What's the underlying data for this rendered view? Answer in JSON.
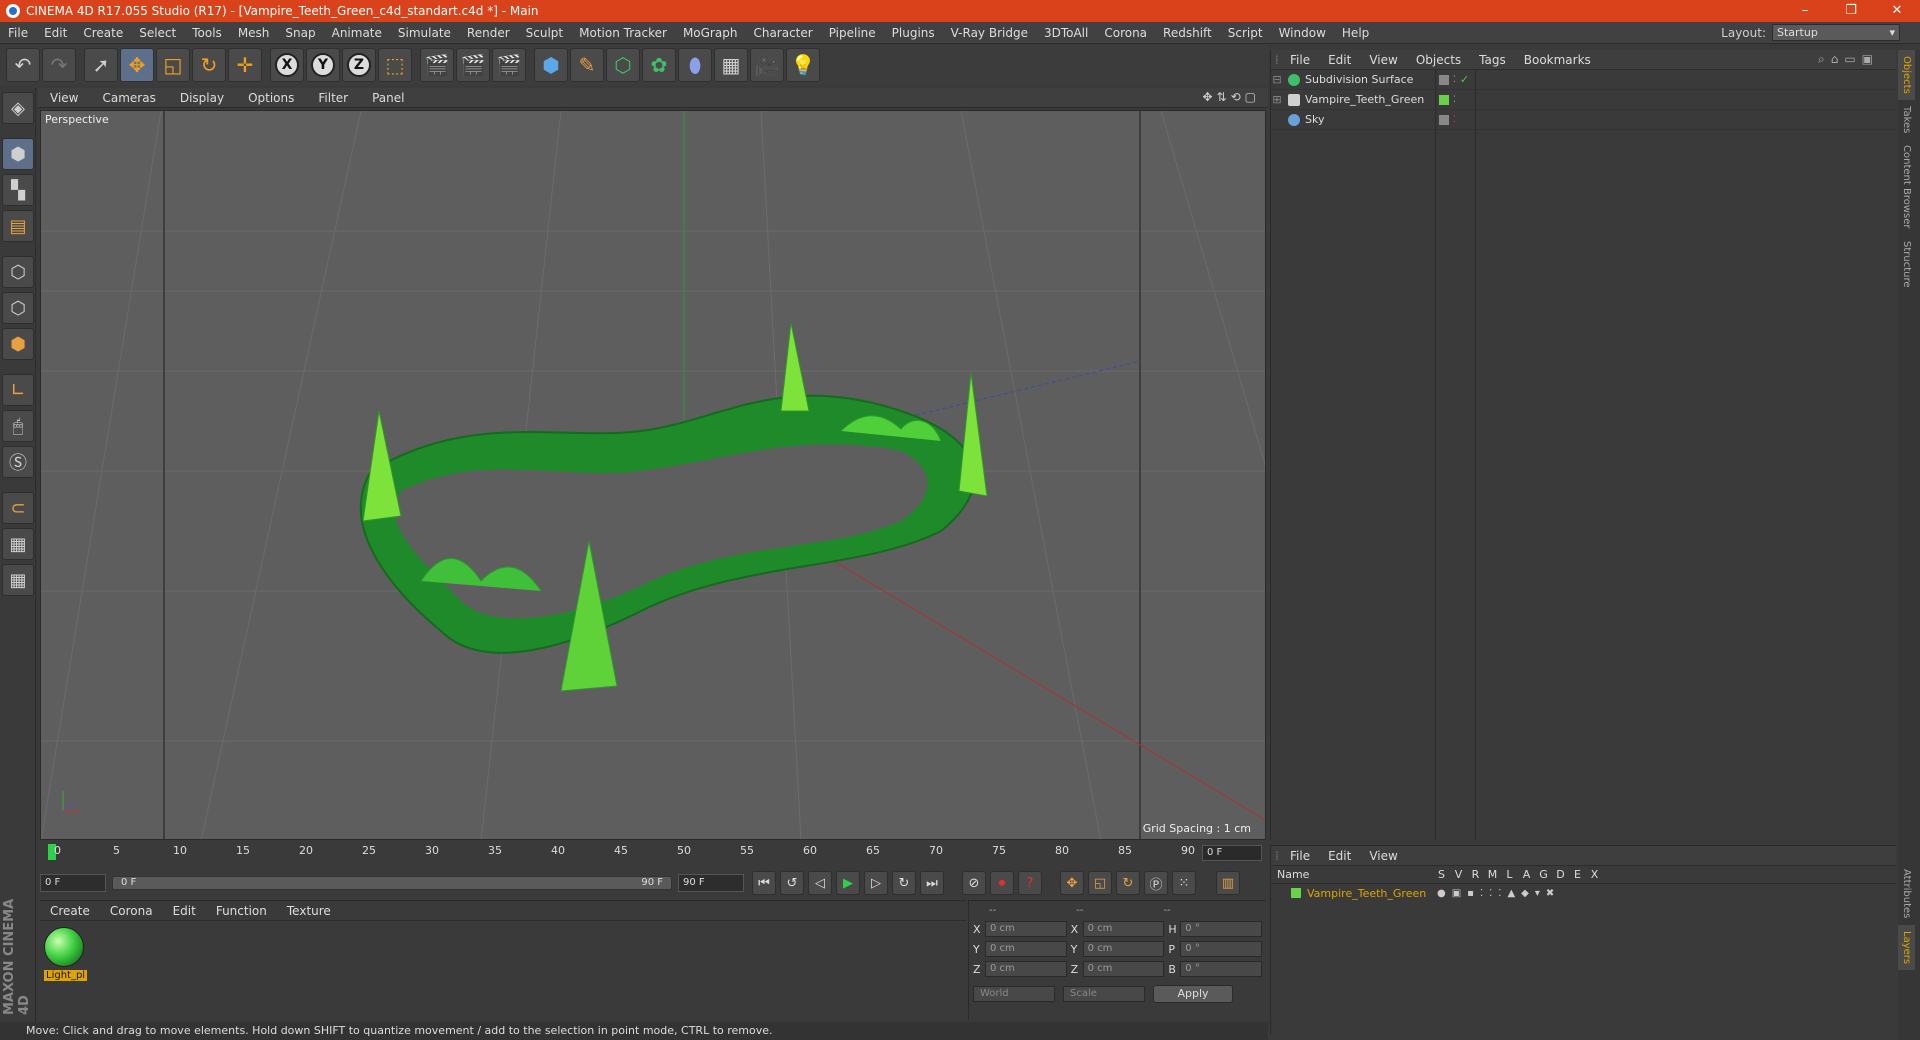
{
  "window": {
    "title": "CINEMA 4D R17.055 Studio (R17) - [Vampire_Teeth_Green_c4d_standart.c4d *] - Main",
    "controls": [
      "–",
      "❐",
      "✕"
    ]
  },
  "menubar": {
    "items": [
      "File",
      "Edit",
      "Create",
      "Select",
      "Tools",
      "Mesh",
      "Snap",
      "Animate",
      "Simulate",
      "Render",
      "Sculpt",
      "Motion Tracker",
      "MoGraph",
      "Character",
      "Pipeline",
      "Plugins",
      "V-Ray Bridge",
      "3DToAll",
      "Corona",
      "Redshift",
      "Script",
      "Window",
      "Help"
    ],
    "layout_label": "Layout:",
    "layout_value": "Startup"
  },
  "viewport": {
    "menu": [
      "View",
      "Cameras",
      "Display",
      "Options",
      "Filter",
      "Panel"
    ],
    "camera_label": "Perspective",
    "grid_spacing": "Grid Spacing : 1 cm"
  },
  "timeline": {
    "ticks": [
      "0",
      "5",
      "10",
      "15",
      "20",
      "25",
      "30",
      "35",
      "40",
      "45",
      "50",
      "55",
      "60",
      "65",
      "70",
      "75",
      "80",
      "85",
      "90"
    ],
    "current_frame": "0 F"
  },
  "transport": {
    "start_frame": "0 F",
    "slider_start": "0 F",
    "slider_end": "90 F",
    "end_frame": "90 F"
  },
  "material_manager": {
    "menu": [
      "Create",
      "Corona",
      "Edit",
      "Function",
      "Texture"
    ],
    "materials": [
      {
        "name": "Light_pl"
      }
    ]
  },
  "coordinates": {
    "headers": [
      "--",
      "--",
      "--"
    ],
    "rows": [
      {
        "a_label": "X",
        "a_value": "0 cm",
        "b_label": "X",
        "b_value": "0 cm",
        "c_label": "H",
        "c_value": "0 °"
      },
      {
        "a_label": "Y",
        "a_value": "0 cm",
        "b_label": "Y",
        "b_value": "0 cm",
        "c_label": "P",
        "c_value": "0 °"
      },
      {
        "a_label": "Z",
        "a_value": "0 cm",
        "b_label": "Z",
        "b_value": "0 cm",
        "c_label": "B",
        "c_value": "0 °"
      }
    ],
    "mode_select": "World",
    "transform_select": "Scale",
    "apply_label": "Apply"
  },
  "object_manager": {
    "menu": [
      "File",
      "Edit",
      "View",
      "Objects",
      "Tags",
      "Bookmarks"
    ],
    "objects": [
      {
        "name": "Subdivision Surface",
        "icon_color": "#3fbf6a"
      },
      {
        "name": "Vampire_Teeth_Green",
        "icon_color": "#cfcfcf"
      },
      {
        "name": "Sky",
        "icon_color": "#6aa0d8"
      }
    ]
  },
  "side_tabs": [
    "Objects",
    "Takes",
    "Content Browser",
    "Structure"
  ],
  "side_tabs_bottom": [
    "Attributes",
    "Layers"
  ],
  "layer_manager": {
    "menu": [
      "File",
      "Edit",
      "View"
    ],
    "columns": [
      "Name",
      "S",
      "V",
      "R",
      "M",
      "L",
      "A",
      "G",
      "D",
      "E",
      "X"
    ],
    "layers": [
      {
        "name": "Vampire_Teeth_Green",
        "color": "#69d14a"
      }
    ]
  },
  "status": "Move: Click and drag to move elements. Hold down SHIFT to quantize movement / add to the selection in point mode, CTRL to remove.",
  "logo": {
    "brand": "MAXON",
    "product": "CINEMA 4D"
  },
  "colors": {
    "title_bar": "#d9421a",
    "accent": "#e0a400",
    "model_green": "#2fc83a"
  }
}
